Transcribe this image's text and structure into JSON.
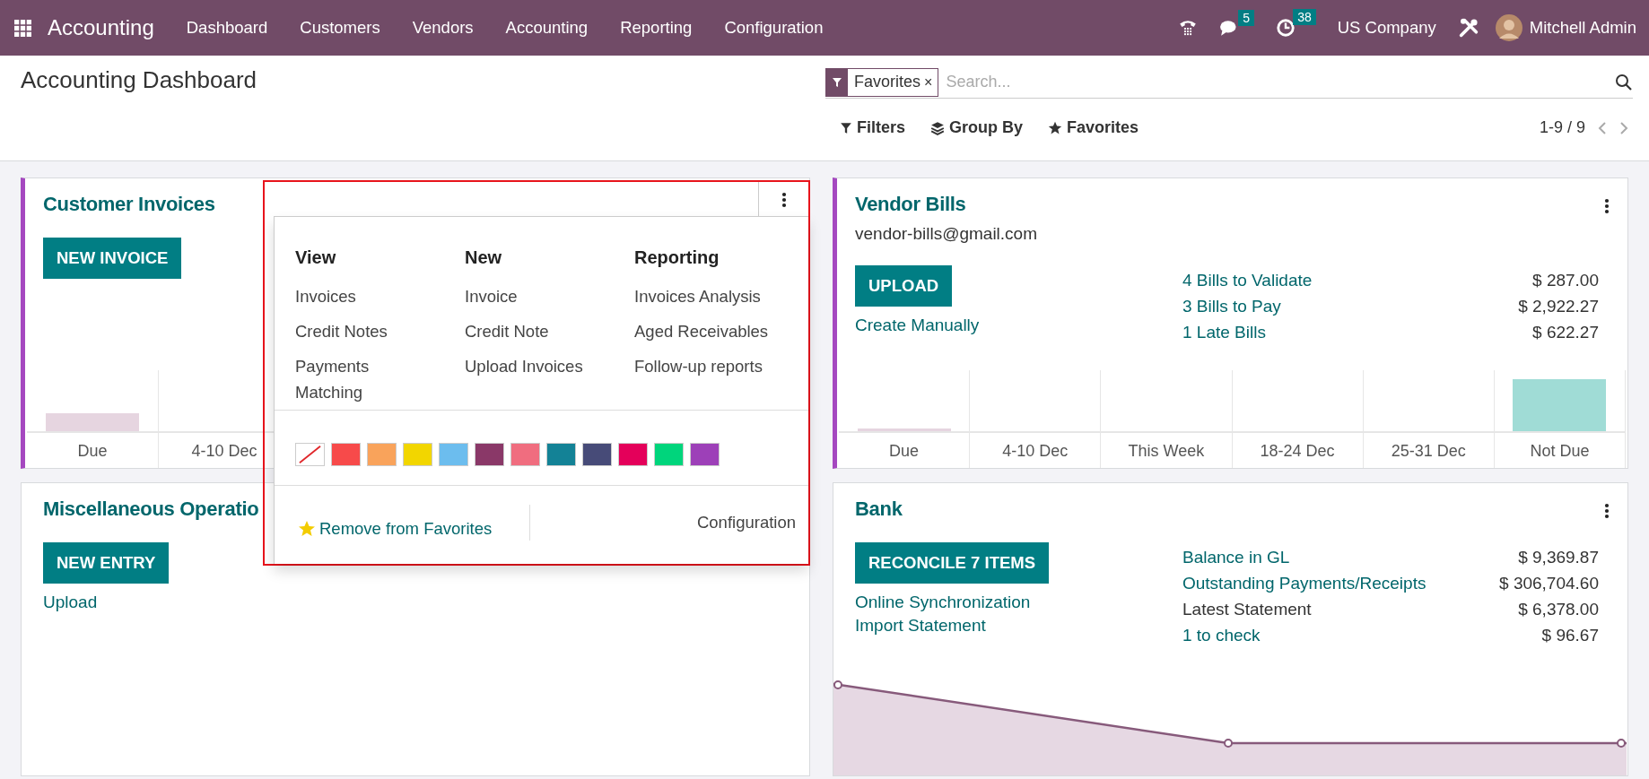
{
  "navbar": {
    "app_name": "Accounting",
    "menu": [
      "Dashboard",
      "Customers",
      "Vendors",
      "Accounting",
      "Reporting",
      "Configuration"
    ],
    "messages_count": "5",
    "activities_count": "38",
    "company": "US Company",
    "user": "Mitchell Admin"
  },
  "control_panel": {
    "title": "Accounting Dashboard",
    "search": {
      "facet": "Favorites",
      "facet_remove": "×",
      "placeholder": "Search..."
    },
    "buttons": [
      "Filters",
      "Group By",
      "Favorites"
    ],
    "pager": "1-9 / 9"
  },
  "cards": [
    {
      "kind": "sales",
      "title": "Customer Invoices",
      "button": "NEW INVOICE",
      "chart_labels": [
        "Due",
        "4-10 Dec"
      ]
    },
    {
      "kind": "purchase",
      "title": "Vendor Bills",
      "email": "vendor-bills@gmail.com",
      "button": "UPLOAD",
      "links": [
        "Create Manually"
      ],
      "stats": [
        {
          "label": "4 Bills to Validate",
          "amount": "$ 287.00",
          "kind": "link"
        },
        {
          "label": "3 Bills to Pay",
          "amount": "$ 2,922.27",
          "kind": "link"
        },
        {
          "label": "1 Late Bills",
          "amount": "$ 622.27",
          "kind": "link"
        }
      ],
      "chart_labels": [
        "Due",
        "4-10 Dec",
        "This Week",
        "18-24 Dec",
        "25-31 Dec",
        "Not Due"
      ]
    },
    {
      "kind": "general",
      "title": "Miscellaneous Operatio",
      "button": "NEW ENTRY",
      "links": [
        "Upload"
      ]
    },
    {
      "kind": "bank",
      "title": "Bank",
      "button": "RECONCILE 7 ITEMS",
      "links": [
        "Online Synchronization",
        "Import Statement"
      ],
      "stats": [
        {
          "label": "Balance in GL",
          "amount": "$ 9,369.87",
          "kind": "link"
        },
        {
          "label": "Outstanding Payments/Receipts",
          "amount": "$ 306,704.60",
          "kind": "link"
        },
        {
          "label": "Latest Statement",
          "amount": "$ 6,378.00",
          "kind": "text"
        },
        {
          "label": "1 to check",
          "amount": "$ 96.67",
          "kind": "link"
        }
      ]
    }
  ],
  "dropdown": {
    "columns": [
      {
        "heading": "View",
        "items": [
          "Invoices",
          "Credit Notes",
          "Payments Matching"
        ]
      },
      {
        "heading": "New",
        "items": [
          "Invoice",
          "Credit Note",
          "Upload Invoices"
        ]
      },
      {
        "heading": "Reporting",
        "items": [
          "Invoices Analysis",
          "Aged Receivables",
          "Follow-up reports"
        ]
      }
    ],
    "colors": [
      {
        "kind": "none",
        "color": "#ffffff"
      },
      {
        "kind": "color",
        "color": "#f74a4a"
      },
      {
        "kind": "color",
        "color": "#f9a35b"
      },
      {
        "kind": "color",
        "color": "#f2d600"
      },
      {
        "kind": "color",
        "color": "#6cbdee"
      },
      {
        "kind": "color",
        "color": "#8a3868"
      },
      {
        "kind": "color",
        "color": "#f06d7f"
      },
      {
        "kind": "color",
        "color": "#138296"
      },
      {
        "kind": "color",
        "color": "#474b78"
      },
      {
        "kind": "color",
        "color": "#e4005a"
      },
      {
        "kind": "color",
        "color": "#00d57c"
      },
      {
        "kind": "color",
        "color": "#9d40b8"
      }
    ],
    "favorite_action": "Remove from Favorites",
    "configuration": "Configuration"
  }
}
